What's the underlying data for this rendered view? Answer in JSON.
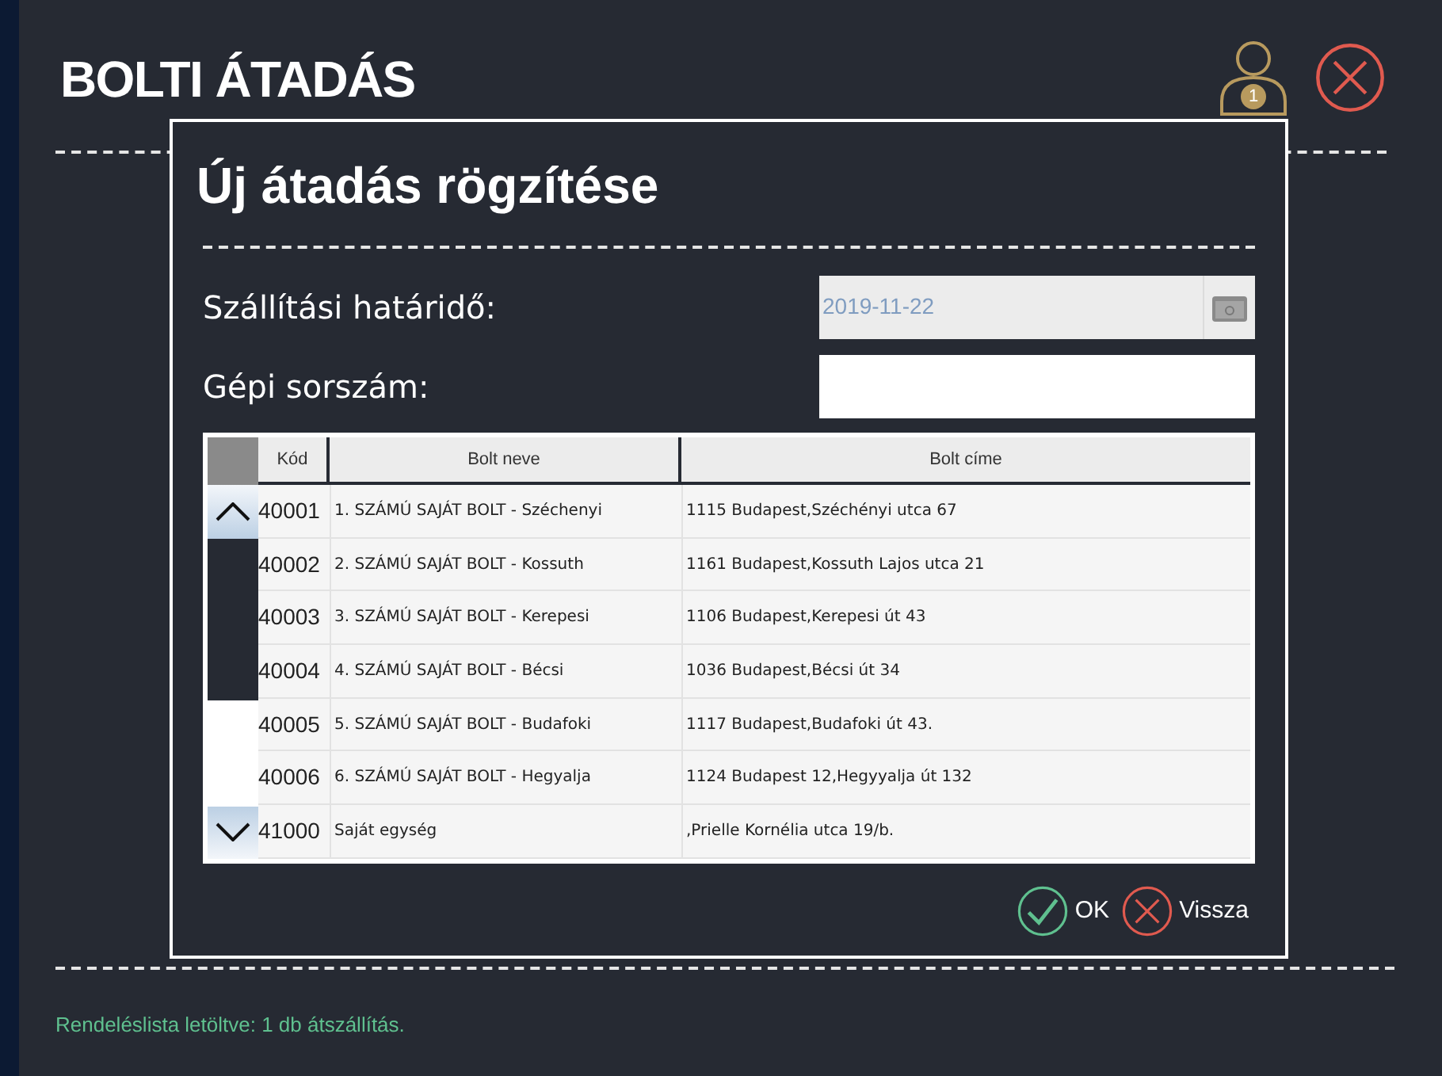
{
  "header": {
    "title": "BOLTI ÁTADÁS",
    "user_badge": "1"
  },
  "dialog": {
    "title": "Új átadás rögzítése",
    "fields": [
      {
        "label": "Szállítási határidő:",
        "value": "2019-11-22",
        "kind": "date",
        "disabled": true
      },
      {
        "label": "Gépi sorszám:",
        "kind": "text",
        "disabled": false
      }
    ],
    "table": {
      "columns": [
        "Kód",
        "Bolt neve",
        "Bolt címe"
      ],
      "rows": [
        [
          "40001",
          "1. SZÁMÚ SAJÁT BOLT - Széchenyi",
          "1115 Budapest,Széchényi utca 67"
        ],
        [
          "40002",
          "2. SZÁMÚ SAJÁT BOLT - Kossuth",
          "1161 Budapest,Kossuth Lajos utca 21"
        ],
        [
          "40003",
          "3. SZÁMÚ SAJÁT BOLT - Kerepesi",
          "1106 Budapest,Kerepesi út 43"
        ],
        [
          "40004",
          "4. SZÁMÚ SAJÁT BOLT - Bécsi",
          "1036 Budapest,Bécsi út 34"
        ],
        [
          "40005",
          "5. SZÁMÚ SAJÁT BOLT - Budafoki",
          "1117 Budapest,Budafoki út 43."
        ],
        [
          "40006",
          "6. SZÁMÚ SAJÁT BOLT - Hegyalja",
          "1124 Budapest 12,Hegyyalja út 132"
        ],
        [
          "41000",
          "Saját egység",
          ",Prielle Kornélia utca 19/b."
        ]
      ]
    },
    "buttons": [
      {
        "label": "OK",
        "kind": "ok"
      },
      {
        "label": "Vissza",
        "kind": "cancel"
      }
    ]
  },
  "status_bar": "Rendeléslista letöltve: 1 db átszállítás."
}
